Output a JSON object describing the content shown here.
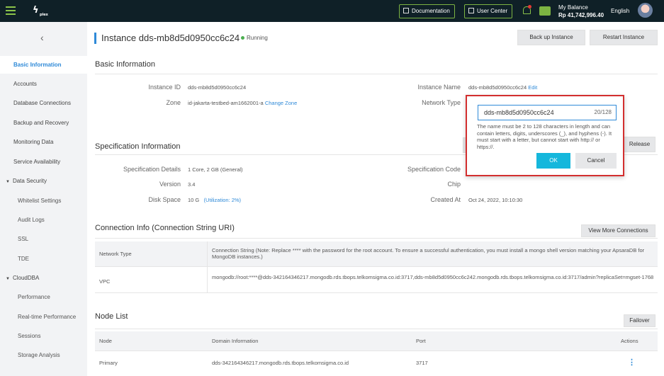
{
  "topbar": {
    "documentation": "Documentation",
    "user_center": "User Center",
    "balance_label": "My Balance",
    "balance_value": "Rp 41,742,996.40",
    "language": "English"
  },
  "sidebar": {
    "items": [
      {
        "label": "Basic Information"
      },
      {
        "label": "Accounts"
      },
      {
        "label": "Database Connections"
      },
      {
        "label": "Backup and Recovery"
      },
      {
        "label": "Monitoring Data"
      },
      {
        "label": "Service Availability"
      },
      {
        "label": "Data Security"
      },
      {
        "label": "Whitelist Settings"
      },
      {
        "label": "Audit Logs"
      },
      {
        "label": "SSL"
      },
      {
        "label": "TDE"
      },
      {
        "label": "CloudDBA"
      },
      {
        "label": "Performance"
      },
      {
        "label": "Real-time Performance"
      },
      {
        "label": "Sessions"
      },
      {
        "label": "Storage Analysis"
      }
    ]
  },
  "header": {
    "title": "Instance dds-mb8d5d0950cc6c24",
    "status": "Running",
    "backup_button": "Back up Instance",
    "restart_button": "Restart Instance"
  },
  "basic": {
    "heading": "Basic Information",
    "instance_id_label": "Instance ID",
    "instance_id": "dds-mb8d5d0950cc6c24",
    "zone_label": "Zone",
    "zone": "id-jakarta-testbed-am1662001-a",
    "change_zone": "Change Zone",
    "instance_name_label": "Instance Name",
    "instance_name": "dds-mb8d5d0950cc6c24",
    "edit": "Edit",
    "network_type_label": "Network Type"
  },
  "spec": {
    "heading": "Specification Information",
    "release_button": "Release",
    "details_label": "Specification Details",
    "details": "1 Core, 2 GB (General)",
    "version_label": "Version",
    "version": "3.4",
    "disk_label": "Disk Space",
    "disk": "10 G",
    "utilization": "(Utilization: 2%)",
    "code_label": "Specification Code",
    "chip_label": "Chip",
    "created_label": "Created At",
    "created": "Oct 24, 2022, 10:10:30"
  },
  "connection": {
    "heading": "Connection Info (Connection String URI)",
    "view_more": "View More Connections",
    "col_network": "Network Type",
    "col_string": "Connection String (Note: Replace **** with the password for the root account. To ensure a successful authentication, you must install a mongo shell version matching your ApsaraDB for MongoDB instances.)",
    "row_type": "VPC",
    "row_string": "mongodb://root:****@dds-342164346217.mongodb.rds.tbops.telkomsigma.co.id:3717,dds-mb8d5d0950cc6c242.mongodb.rds.tbops.telkomsigma.co.id:3717/admin?replicaSet=mgset-1768"
  },
  "nodes": {
    "heading": "Node List",
    "failover": "Failover",
    "col_node": "Node",
    "col_domain": "Domain Information",
    "col_port": "Port",
    "col_actions": "Actions",
    "row_node": "Primary",
    "row_domain": "dds-342164346217.mongodb.rds.tbops.telkomsigma.co.id",
    "row_port": "3717"
  },
  "popup": {
    "value": "dds-mb8d5d0950cc6c24",
    "count": "20/128",
    "help": "The name must be 2 to 128 characters in length and can contain letters, digits, underscores (_), and hyphens (-). It must start with a letter, but cannot start with http:// or https://.",
    "ok": "OK",
    "cancel": "Cancel"
  }
}
